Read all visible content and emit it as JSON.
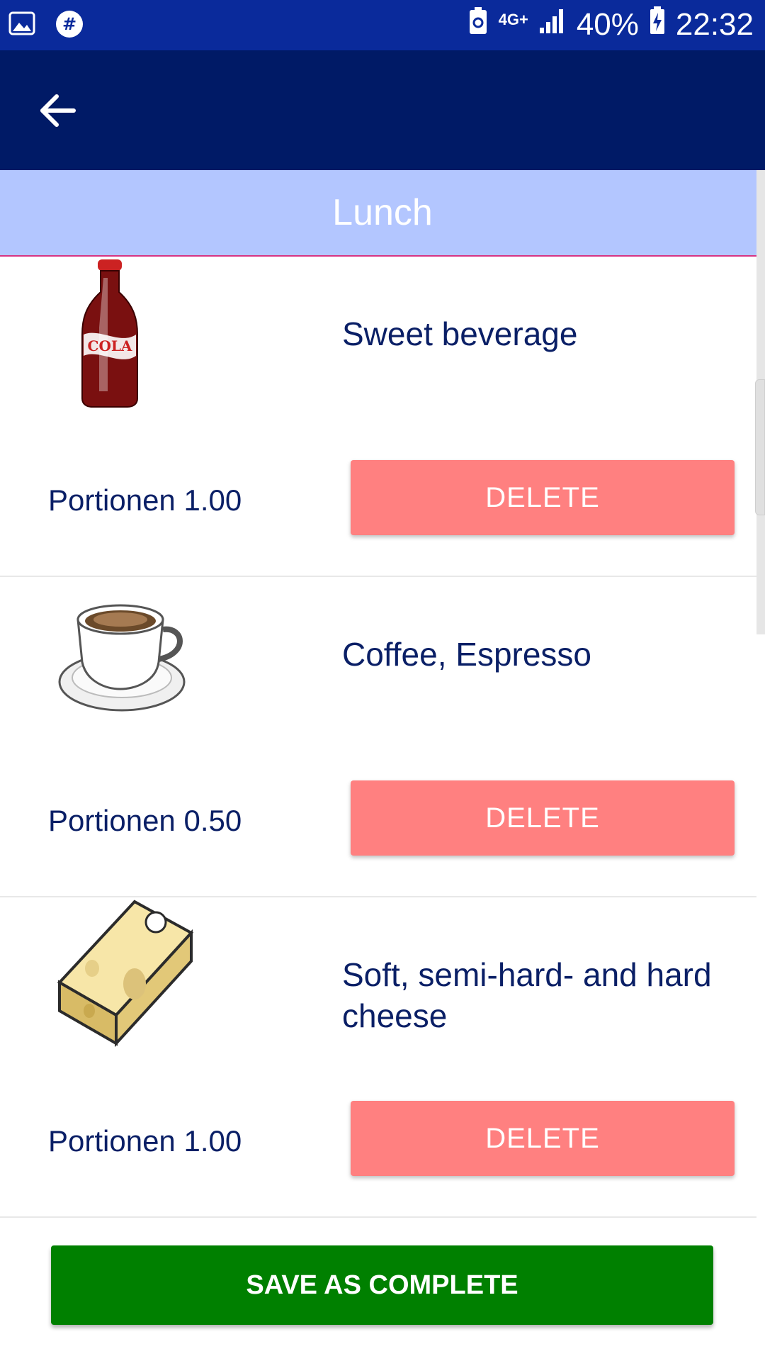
{
  "status_bar": {
    "network": "4G+",
    "battery": "40%",
    "time": "22:32",
    "icons": [
      "gallery-icon",
      "hashtag-icon",
      "battery-saver-icon",
      "network-icon",
      "signal-icon",
      "battery-icon"
    ]
  },
  "app_bar": {
    "back_icon": "arrow-back-icon"
  },
  "section": {
    "title": "Lunch"
  },
  "items": [
    {
      "name": "Sweet beverage",
      "portions": "Portionen 1.00",
      "delete_label": "DELETE",
      "icon": "cola-bottle-icon"
    },
    {
      "name": "Coffee, Espresso",
      "portions": "Portionen 0.50",
      "delete_label": "DELETE",
      "icon": "coffee-cup-icon"
    },
    {
      "name": "Soft, semi-hard- and hard cheese",
      "portions": "Portionen 1.00",
      "delete_label": "DELETE",
      "icon": "cheese-icon"
    }
  ],
  "save_button": {
    "label": "SAVE AS COMPLETE"
  },
  "colors": {
    "status_bar": "#0a2a9b",
    "app_bar": "#001a66",
    "section_header": "#b3c6ff",
    "delete_button": "#ff8080",
    "save_button": "#008000",
    "text": "#0a1f66"
  }
}
